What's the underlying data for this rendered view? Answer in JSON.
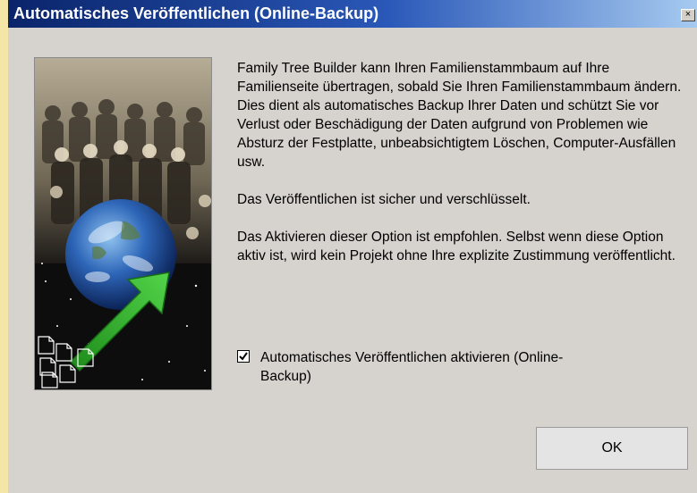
{
  "window": {
    "title": "Automatisches Veröffentlichen (Online-Backup)",
    "close_icon": "×"
  },
  "content": {
    "paragraphs": [
      "Family Tree Builder kann Ihren Familienstammbaum auf Ihre Familienseite übertragen, sobald Sie Ihren Familienstammbaum ändern. Dies dient als automatisches Backup Ihrer Daten und schützt Sie vor Verlust oder Beschädigung der Daten aufgrund von Problemen wie Absturz der Festplatte, unbeabsichtigtem Löschen, Computer-Ausfällen usw.",
      "Das Veröffentlichen ist sicher und verschlüsselt.",
      "Das Aktivieren dieser Option ist empfohlen. Selbst wenn diese Option aktiv ist, wird kein Projekt ohne Ihre explizite Zustimmung veröffentlicht."
    ],
    "checkbox": {
      "label": "Automatisches Veröffentlichen aktivieren (Online-Backup)",
      "checked": true
    }
  },
  "buttons": {
    "ok_label": "OK"
  },
  "colors": {
    "title_bar_start": "#0a246a",
    "title_bar_end": "#a6caf0",
    "dialog_background": "#d6d3ce",
    "arrow_green": "#2fa526"
  },
  "icons": {
    "picture": "family-photo-globe-arrow-illustration"
  }
}
